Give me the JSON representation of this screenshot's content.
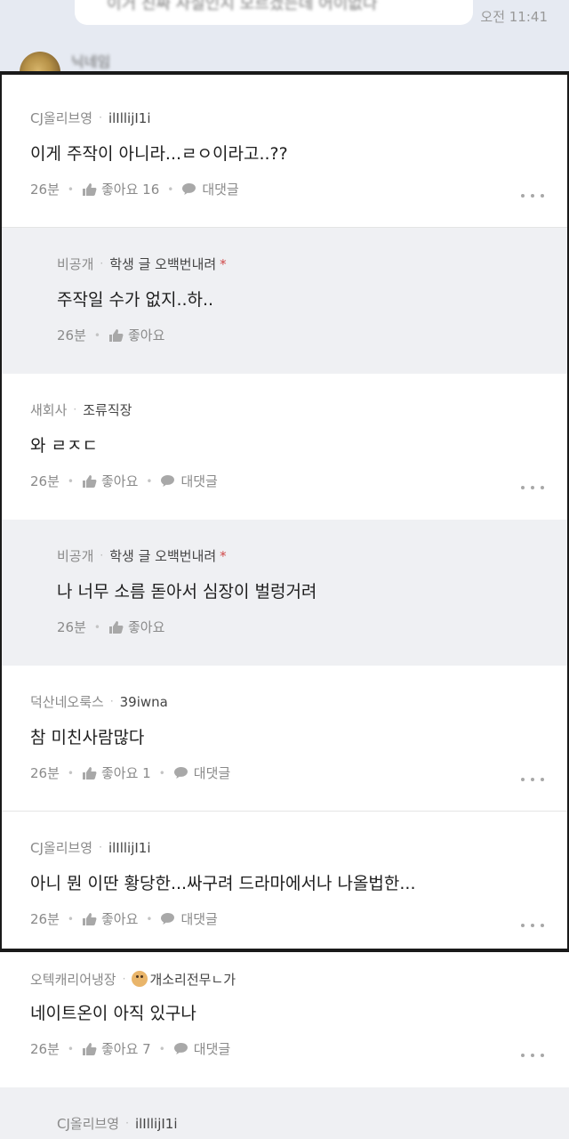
{
  "chat": {
    "time": "오전 11:41",
    "bubble_text": "이거 진짜 사실인지 모르겠는데 어이없다",
    "sender_name": "닉네임"
  },
  "comments": [
    {
      "company": "CJ올리브영",
      "nick": "ilIllijI1i",
      "text": "이게 주작이 아니라...ㄹㅇ이라고..??",
      "time": "26분",
      "like_label": "좋아요",
      "like_count": "16",
      "reply_label": "대댓글"
    },
    {
      "company": "비공개",
      "nick": "학생 글 오백번내려",
      "star": "*",
      "text": "주작일 수가 없지..하..",
      "time": "26분",
      "like_label": "좋아요"
    },
    {
      "company": "새회사",
      "nick": "조류직장",
      "text": "와 ㄹㅈㄷ",
      "time": "26분",
      "like_label": "좋아요",
      "reply_label": "대댓글"
    },
    {
      "company": "비공개",
      "nick": "학생 글 오백번내려",
      "star": "*",
      "text": "나 너무 소름 돋아서 심장이 벌렁거려",
      "time": "26분",
      "like_label": "좋아요"
    },
    {
      "company": "덕산네오룩스",
      "nick": "39iwna",
      "text": "참 미친사람많다",
      "time": "26분",
      "like_label": "좋아요",
      "like_count": "1",
      "reply_label": "대댓글"
    },
    {
      "company": "CJ올리브영",
      "nick": "ilIllijI1i",
      "text": "아니 뭔 이딴 황당한...싸구려 드라마에서나 나올법한...",
      "time": "26분",
      "like_label": "좋아요",
      "reply_label": "대댓글"
    },
    {
      "company": "오텍캐리어냉장",
      "nick": "개소리전무ㄴ가",
      "nick_icon": "dog-emoji-icon",
      "text": "네이트온이 아직 있구나",
      "time": "26분",
      "like_label": "좋아요",
      "like_count": "7",
      "reply_label": "대댓글"
    },
    {
      "company": "CJ올리브영",
      "nick": "ilIllijI1i"
    }
  ],
  "colors": {
    "reply_bg": "#eff0f3",
    "divider": "#1a1a1a",
    "star": "#d04848",
    "chat_bg": "#e6eaf2"
  }
}
